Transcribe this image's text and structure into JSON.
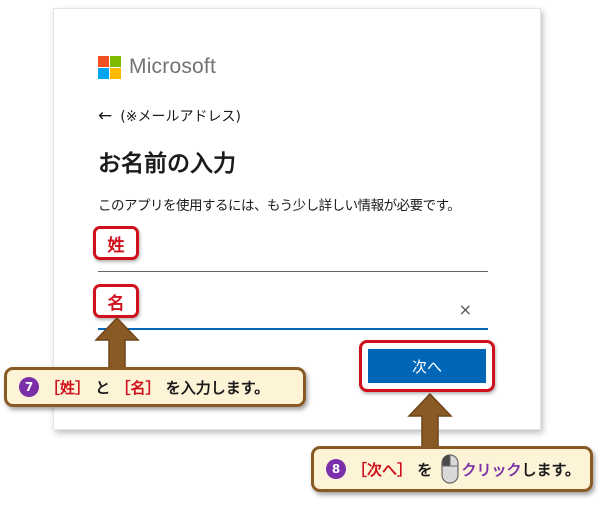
{
  "logo": {
    "text": "Microsoft",
    "colors": [
      "#f25022",
      "#7fba00",
      "#00a4ef",
      "#ffb900"
    ]
  },
  "back": {
    "arrow": "←",
    "email_label": "(※メールアドレス)"
  },
  "heading": "お名前の入力",
  "description": "このアプリを使用するには、もう少し詳しい情報が必要です。",
  "fields": {
    "last_name": {
      "badge": "姓",
      "value": ""
    },
    "first_name": {
      "badge": "名",
      "value": "",
      "clear": "×"
    }
  },
  "next_button": {
    "label": "次へ"
  },
  "callout1": {
    "number": "7",
    "open1": "［",
    "word1": "姓",
    "close1": "］",
    "particle1": " と ",
    "open2": "［",
    "word2": "名",
    "close2": "］",
    "rest": " を入力します。"
  },
  "callout2": {
    "number": "8",
    "open": "［",
    "word": "次へ",
    "close": "］",
    "particle": " を ",
    "action": "クリック",
    "rest": "します。"
  },
  "colors": {
    "accent": "#0067b8",
    "highlight": "#d0101d",
    "callout_border": "#8a5a24",
    "callout_bg": "#fdf4d8",
    "step_number": "#7b2fa8"
  },
  "icons": [
    "back-arrow-icon",
    "clear-icon",
    "mouse-icon",
    "arrow-up-icon"
  ]
}
